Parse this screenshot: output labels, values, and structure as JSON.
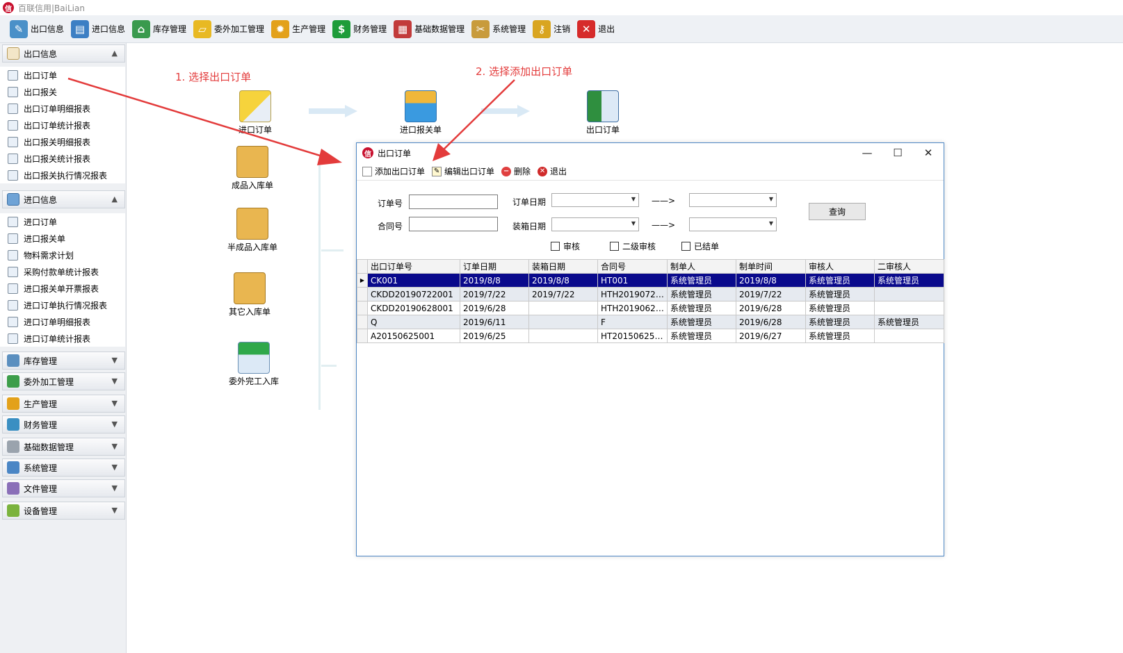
{
  "app": {
    "title": "百联信用|BaiLian",
    "logo_text": "信"
  },
  "toolbar": [
    {
      "label": "出口信息",
      "icon": "pencil-notepad-icon",
      "color": "#4a90c8",
      "glyph": "✎"
    },
    {
      "label": "进口信息",
      "icon": "basket-icon",
      "color": "#3c7fc4",
      "glyph": "▤"
    },
    {
      "label": "库存管理",
      "icon": "warehouse-icon",
      "color": "#3a9a4e",
      "glyph": "⌂"
    },
    {
      "label": "委外加工管理",
      "icon": "folder-icon",
      "color": "#e8b923",
      "glyph": "▱"
    },
    {
      "label": "生产管理",
      "icon": "gear-icon",
      "color": "#e3a11a",
      "glyph": "✹"
    },
    {
      "label": "财务管理",
      "icon": "dollar-icon",
      "color": "#1e9c3a",
      "glyph": "$"
    },
    {
      "label": "基础数据管理",
      "icon": "calendar-grid-icon",
      "color": "#c23b3b",
      "glyph": "▦"
    },
    {
      "label": "系统管理",
      "icon": "tools-icon",
      "color": "#c89b3c",
      "glyph": "✂"
    },
    {
      "label": "注销",
      "icon": "key-icon",
      "color": "#d9a520",
      "glyph": "⚷"
    },
    {
      "label": "退出",
      "icon": "close-red-icon",
      "color": "#d62b2b",
      "glyph": "✕"
    }
  ],
  "sidebar": {
    "export": {
      "label": "出口信息",
      "icon": "tag-icon",
      "items": [
        "出口订单",
        "出口报关",
        "出口订单明细报表",
        "出口订单统计报表",
        "出口报关明细报表",
        "出口报关统计报表",
        "出口报关执行情况报表"
      ]
    },
    "import": {
      "label": "进口信息",
      "icon": "box-icon",
      "items": [
        "进口订单",
        "进口报关单",
        "物料需求计划",
        "采购付款单统计报表",
        "进口报关单开票报表",
        "进口订单执行情况报表",
        "进口订单明细报表",
        "进口订单统计报表"
      ]
    },
    "groups": [
      {
        "label": "库存管理",
        "icon": "warehouse-icon",
        "color": "#5b8fbf"
      },
      {
        "label": "委外加工管理",
        "icon": "clipboard-icon",
        "color": "#3d9e4a"
      },
      {
        "label": "生产管理",
        "icon": "gear-icon",
        "color": "#e3a11a"
      },
      {
        "label": "财务管理",
        "icon": "money-icon",
        "color": "#3a8fc2"
      },
      {
        "label": "基础数据管理",
        "icon": "eraser-icon",
        "color": "#9aa3ad"
      },
      {
        "label": "系统管理",
        "icon": "monitor-icon",
        "color": "#4a86c5"
      },
      {
        "label": "文件管理",
        "icon": "pen-icon",
        "color": "#8a6fb8"
      },
      {
        "label": "设备管理",
        "icon": "cube-icon",
        "color": "#7bb33d"
      }
    ]
  },
  "workflow": {
    "nodes": [
      {
        "label": "进口订单",
        "icon": "clipboard-icon"
      },
      {
        "label": "进口报关单",
        "icon": "folder-download-icon"
      },
      {
        "label": "出口订单",
        "icon": "contact-card-icon"
      },
      {
        "label": "成品入库单",
        "icon": "boxes-icon"
      },
      {
        "label": "半成品入库单",
        "icon": "boxes-icon"
      },
      {
        "label": "其它入库单",
        "icon": "boxes-icon"
      },
      {
        "label": "委外完工入库",
        "icon": "check-document-icon"
      }
    ],
    "annotations": [
      "1. 选择出口订单",
      "2. 选择添加出口订单"
    ]
  },
  "window": {
    "title": "出口订单",
    "logo_text": "信",
    "tools": [
      {
        "label": "添加出口订单",
        "icon": "new-document-icon"
      },
      {
        "label": "编辑出口订单",
        "icon": "edit-document-icon"
      },
      {
        "label": "删除",
        "icon": "minus-circle-icon"
      },
      {
        "label": "退出",
        "icon": "close-circle-icon"
      }
    ],
    "query": {
      "order_no_label": "订单号",
      "contract_no_label": "合同号",
      "order_date_label": "订单日期",
      "packing_date_label": "装箱日期",
      "range_arrow": "——>",
      "checks": [
        "审核",
        "二级审核",
        "已结单"
      ],
      "button": "查询"
    },
    "table": {
      "columns": [
        "出口订单号",
        "订单日期",
        "装箱日期",
        "合同号",
        "制单人",
        "制单时间",
        "审核人",
        "二审核人"
      ],
      "rows": [
        [
          "CK001",
          "2019/8/8",
          "2019/8/8",
          "HT001",
          "系统管理员",
          "2019/8/8",
          "系统管理员",
          "系统管理员"
        ],
        [
          "CKDD20190722001",
          "2019/7/22",
          "2019/7/22",
          "HTH20190722...",
          "系统管理员",
          "2019/7/22",
          "系统管理员",
          ""
        ],
        [
          "CKDD20190628001",
          "2019/6/28",
          "",
          "HTH20190628...",
          "系统管理员",
          "2019/6/28",
          "系统管理员",
          ""
        ],
        [
          "Q",
          "2019/6/11",
          "",
          "F",
          "系统管理员",
          "2019/6/28",
          "系统管理员",
          "系统管理员"
        ],
        [
          "A20150625001",
          "2019/6/25",
          "",
          "HT20150625001",
          "系统管理员",
          "2019/6/27",
          "系统管理员",
          ""
        ]
      ]
    }
  }
}
